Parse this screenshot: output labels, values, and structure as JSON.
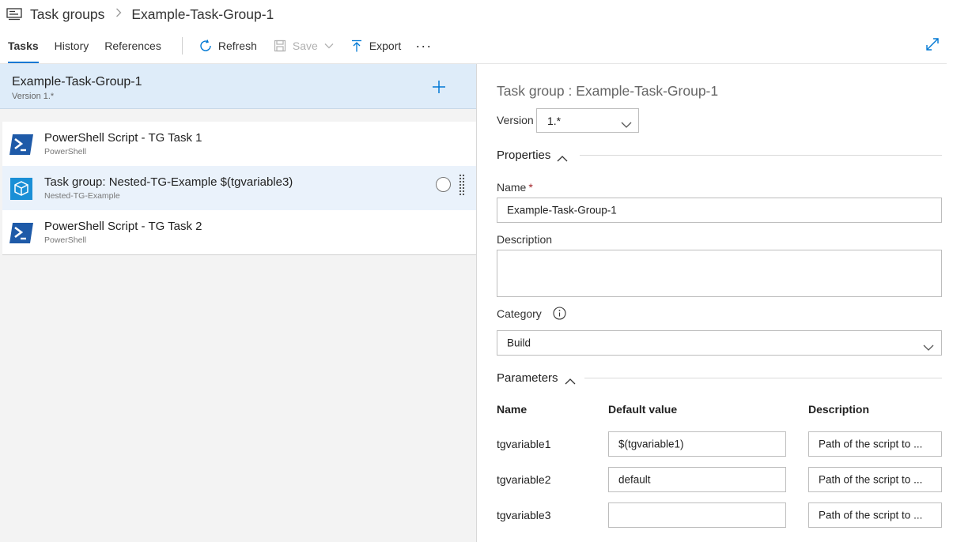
{
  "breadcrumb": {
    "root": "Task groups",
    "separator": ">",
    "current": "Example-Task-Group-1",
    "icon": "task-groups-icon"
  },
  "toolbar": {
    "tabs": [
      "Tasks",
      "History",
      "References"
    ],
    "active_tab": "Tasks",
    "refresh_label": "Refresh",
    "save_label": "Save",
    "export_label": "Export",
    "more_label": "···"
  },
  "left": {
    "group_title": "Example-Task-Group-1",
    "group_version": "Version 1.*",
    "tasks": [
      {
        "title": "PowerShell Script - TG Task 1",
        "subtitle": "PowerShell",
        "icon": "powershell-icon"
      },
      {
        "title": "Task group: Nested-TG-Example $(tgvariable3)",
        "subtitle": "Nested-TG-Example",
        "icon": "task-group-icon"
      },
      {
        "title": "PowerShell Script - TG Task 2",
        "subtitle": "PowerShell",
        "icon": "powershell-icon"
      }
    ]
  },
  "right": {
    "title": "Task group : Example-Task-Group-1",
    "version_label": "Version",
    "version_value": "1.*",
    "properties_label": "Properties",
    "name_label": "Name",
    "required_mark": "*",
    "name_value": "Example-Task-Group-1",
    "description_label": "Description",
    "description_value": "",
    "category_label": "Category",
    "category_value": "Build",
    "parameters_label": "Parameters",
    "param_headers": {
      "name": "Name",
      "default": "Default value",
      "description": "Description"
    },
    "params": [
      {
        "name": "tgvariable1",
        "default": "$(tgvariable1)",
        "description": "Path of the script to ..."
      },
      {
        "name": "tgvariable2",
        "default": "default",
        "description": "Path of the script to ..."
      },
      {
        "name": "tgvariable3",
        "default": "",
        "description": "Path of the script to ..."
      }
    ]
  },
  "colors": {
    "accent": "#0078d4",
    "selected_header": "#deecf9",
    "powershell_blue": "#1e5aa8",
    "task_group_blue": "#1a8fd6"
  }
}
